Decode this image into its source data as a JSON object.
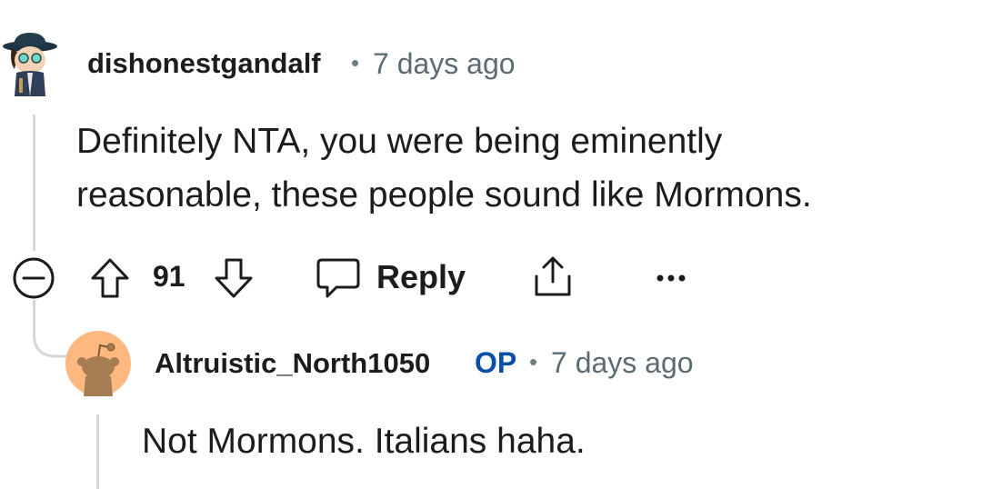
{
  "comment": {
    "username": "dishonestgandalf",
    "separator": "•",
    "timestamp": "7 days ago",
    "body_lines": [
      "Definitely NTA, you were being eminently",
      "reasonable, these people sound like Mormons."
    ],
    "vote_count": "91",
    "reply_label": "Reply",
    "more_label": "•••"
  },
  "reply": {
    "username": "Altruistic_North1050",
    "op_badge": "OP",
    "separator": "•",
    "timestamp": "7 days ago",
    "body": "Not Mormons. Italians haha."
  },
  "colors": {
    "text": "#1c1c1c",
    "meta": "#5c6a73",
    "op": "#0a4fa8",
    "thread_line": "#d7d7d7",
    "snoo_avatar_bg": "#ffb880"
  }
}
